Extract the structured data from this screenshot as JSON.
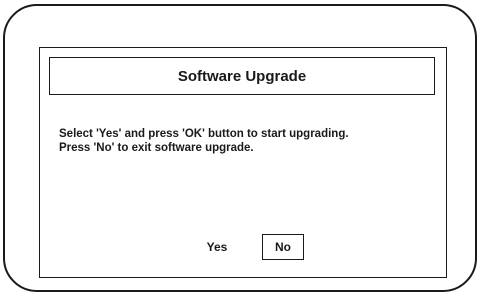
{
  "dialog": {
    "title": "Software Upgrade",
    "message_lines": [
      "Select 'Yes' and press 'OK' button to start upgrading.",
      "Press 'No' to exit software upgrade."
    ],
    "buttons": {
      "yes_label": "Yes",
      "no_label": "No"
    },
    "selected_button": "No"
  },
  "colors": {
    "ink": "#1a1a1a",
    "background": "#ffffff"
  }
}
